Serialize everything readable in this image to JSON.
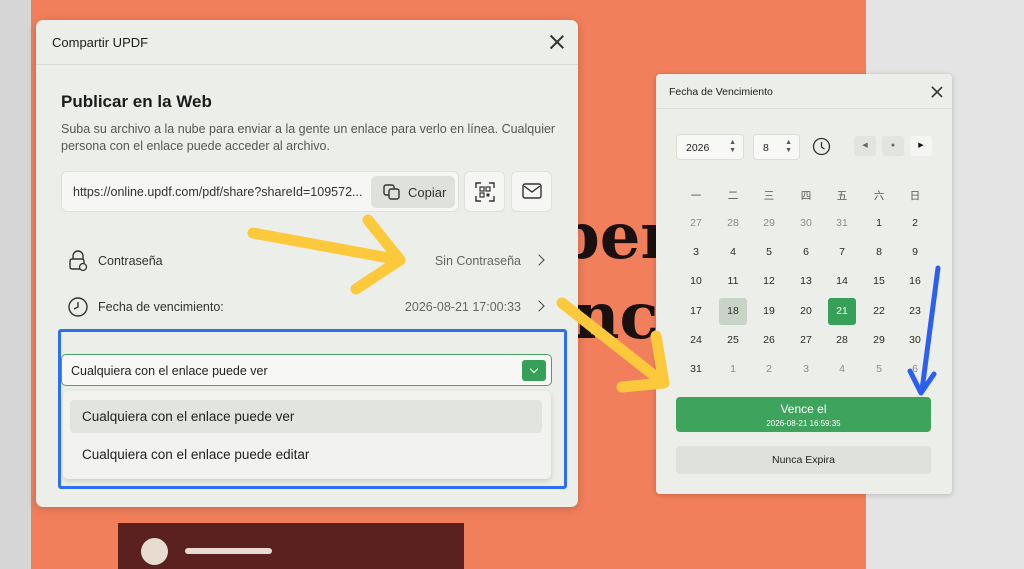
{
  "background": {
    "heading_fragment_1": "ber",
    "heading_fragment_2": "nce"
  },
  "share_dialog": {
    "title": "Compartir UPDF",
    "heading": "Publicar en la Web",
    "description": "Suba su archivo a la nube para enviar a la gente un enlace para verlo en línea. Cualquier persona con el enlace puede acceder al archivo.",
    "url": "https://online.updf.com/pdf/share?shareId=109572...",
    "copy_label": "Copiar",
    "password": {
      "label": "Contraseña",
      "value": "Sin Contraseña"
    },
    "expiry": {
      "label": "Fecha de vencimiento:",
      "value": "2026-08-21 17:00:33"
    },
    "permission": {
      "selected": "Cualquiera con el enlace puede ver",
      "options": [
        "Cualquiera con el enlace puede ver",
        "Cualquiera con el enlace puede editar"
      ]
    }
  },
  "date_picker": {
    "title": "Fecha de Vencimiento",
    "year": "2026",
    "month": "8",
    "weekdays": [
      "一",
      "二",
      "三",
      "四",
      "五",
      "六",
      "日"
    ],
    "weeks": [
      [
        "27",
        "28",
        "29",
        "30",
        "31",
        "1",
        "2"
      ],
      [
        "3",
        "4",
        "5",
        "6",
        "7",
        "8",
        "9"
      ],
      [
        "10",
        "11",
        "12",
        "13",
        "14",
        "15",
        "16"
      ],
      [
        "17",
        "18",
        "19",
        "20",
        "21",
        "22",
        "23"
      ],
      [
        "24",
        "25",
        "26",
        "27",
        "28",
        "29",
        "30"
      ],
      [
        "31",
        "1",
        "2",
        "3",
        "4",
        "5",
        "6"
      ]
    ],
    "today": "18",
    "selected_day": "21",
    "confirm_label": "Vence el",
    "confirm_date": "2026-08-21 16:59:35",
    "never_label": "Nunca Expira"
  },
  "colors": {
    "accent_green": "#36a059",
    "highlight_blue": "#2c6ff3",
    "arrow_yellow": "#fcc83c",
    "background_orange": "#f27f5b"
  }
}
